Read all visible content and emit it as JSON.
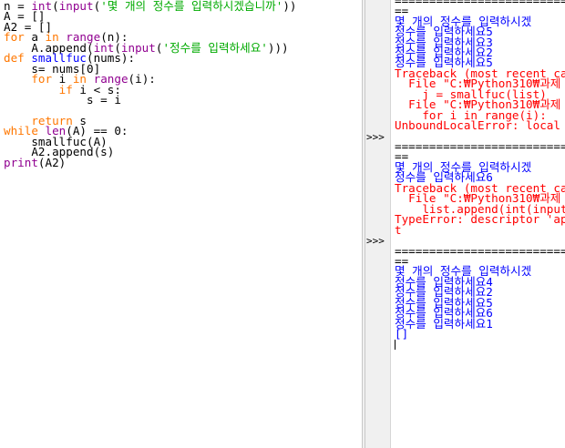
{
  "editor": {
    "lines": [
      [
        {
          "t": "n = ",
          "c": ""
        },
        {
          "t": "int",
          "c": "bi"
        },
        {
          "t": "(",
          "c": ""
        },
        {
          "t": "input",
          "c": "bi"
        },
        {
          "t": "(",
          "c": ""
        },
        {
          "t": "'몇 개의 정수를 입력하시겠습니까'",
          "c": "st"
        },
        {
          "t": "))",
          "c": ""
        }
      ],
      [
        {
          "t": "A = []",
          "c": ""
        }
      ],
      [
        {
          "t": "A2 = []",
          "c": ""
        }
      ],
      [
        {
          "t": "for",
          "c": "kw"
        },
        {
          "t": " a ",
          "c": ""
        },
        {
          "t": "in",
          "c": "kw"
        },
        {
          "t": " ",
          "c": ""
        },
        {
          "t": "range",
          "c": "bi"
        },
        {
          "t": "(n):",
          "c": ""
        }
      ],
      [
        {
          "t": "    A.append(",
          "c": ""
        },
        {
          "t": "int",
          "c": "bi"
        },
        {
          "t": "(",
          "c": ""
        },
        {
          "t": "input",
          "c": "bi"
        },
        {
          "t": "(",
          "c": ""
        },
        {
          "t": "'정수를 입력하세요'",
          "c": "st"
        },
        {
          "t": ")))",
          "c": ""
        }
      ],
      [
        {
          "t": "def",
          "c": "kw"
        },
        {
          "t": " ",
          "c": ""
        },
        {
          "t": "smallfuc",
          "c": "df"
        },
        {
          "t": "(nums):",
          "c": ""
        }
      ],
      [
        {
          "t": "    s= nums[0]",
          "c": ""
        }
      ],
      [
        {
          "t": "    ",
          "c": ""
        },
        {
          "t": "for",
          "c": "kw"
        },
        {
          "t": " i ",
          "c": ""
        },
        {
          "t": "in",
          "c": "kw"
        },
        {
          "t": " ",
          "c": ""
        },
        {
          "t": "range",
          "c": "bi"
        },
        {
          "t": "(i):",
          "c": ""
        }
      ],
      [
        {
          "t": "        ",
          "c": ""
        },
        {
          "t": "if",
          "c": "kw"
        },
        {
          "t": " i < s:",
          "c": ""
        }
      ],
      [
        {
          "t": "            s = i",
          "c": ""
        }
      ],
      [],
      [
        {
          "t": "    ",
          "c": ""
        },
        {
          "t": "return",
          "c": "kw"
        },
        {
          "t": " s",
          "c": ""
        }
      ],
      [
        {
          "t": "while",
          "c": "kw"
        },
        {
          "t": " ",
          "c": ""
        },
        {
          "t": "len",
          "c": "bi"
        },
        {
          "t": "(A) == 0:",
          "c": ""
        }
      ],
      [
        {
          "t": "    smallfuc(A)",
          "c": ""
        }
      ],
      [
        {
          "t": "    A2.append(s)",
          "c": ""
        }
      ],
      [
        {
          "t": "print",
          "c": "bi"
        },
        {
          "t": "(A2)",
          "c": ""
        }
      ]
    ]
  },
  "shell": {
    "prompt": ">>>",
    "lines": [
      {
        "t": "=====================================",
        "c": ""
      },
      {
        "t": "==",
        "c": ""
      },
      {
        "t": "몇 개의 정수를 입력하시겠",
        "c": "out"
      },
      {
        "t": "정수를 입력하세요5",
        "c": "out"
      },
      {
        "t": "정수를 입력하세요3",
        "c": "out"
      },
      {
        "t": "정수를 입력하세요2",
        "c": "out"
      },
      {
        "t": "정수를 입력하세요5",
        "c": "out"
      },
      {
        "t": "Traceback (most recent ca",
        "c": "err"
      },
      {
        "t": "  File \"C:₩Python310₩과제",
        "c": "err"
      },
      {
        "t": "    j = smallfuc(list)",
        "c": "err"
      },
      {
        "t": "  File \"C:₩Python310₩과제",
        "c": "err"
      },
      {
        "t": "    for i in range(i):",
        "c": "err"
      },
      {
        "t": "UnboundLocalError: local ",
        "c": "err"
      },
      {
        "t": "",
        "c": "",
        "p": true
      },
      {
        "t": "=====================================",
        "c": ""
      },
      {
        "t": "==",
        "c": ""
      },
      {
        "t": "몇 개의 정수를 입력하시겠",
        "c": "out"
      },
      {
        "t": "정수를 입력하세요6",
        "c": "out"
      },
      {
        "t": "Traceback (most recent ca",
        "c": "err"
      },
      {
        "t": "  File \"C:₩Python310₩과제",
        "c": "err"
      },
      {
        "t": "    list.append(int(input",
        "c": "err"
      },
      {
        "t": "TypeError: descriptor 'ap",
        "c": "err"
      },
      {
        "t": "t",
        "c": "err"
      },
      {
        "t": "",
        "c": "",
        "p": true
      },
      {
        "t": "=====================================",
        "c": ""
      },
      {
        "t": "==",
        "c": ""
      },
      {
        "t": "몇 개의 정수를 입력하시겠",
        "c": "out"
      },
      {
        "t": "정수를 입력하세요4",
        "c": "out"
      },
      {
        "t": "정수를 입력하세요2",
        "c": "out"
      },
      {
        "t": "정수를 입력하세요5",
        "c": "out"
      },
      {
        "t": "정수를 입력하세요6",
        "c": "out"
      },
      {
        "t": "정수를 입력하세요1",
        "c": "out"
      },
      {
        "t": "[]",
        "c": "out"
      }
    ]
  }
}
